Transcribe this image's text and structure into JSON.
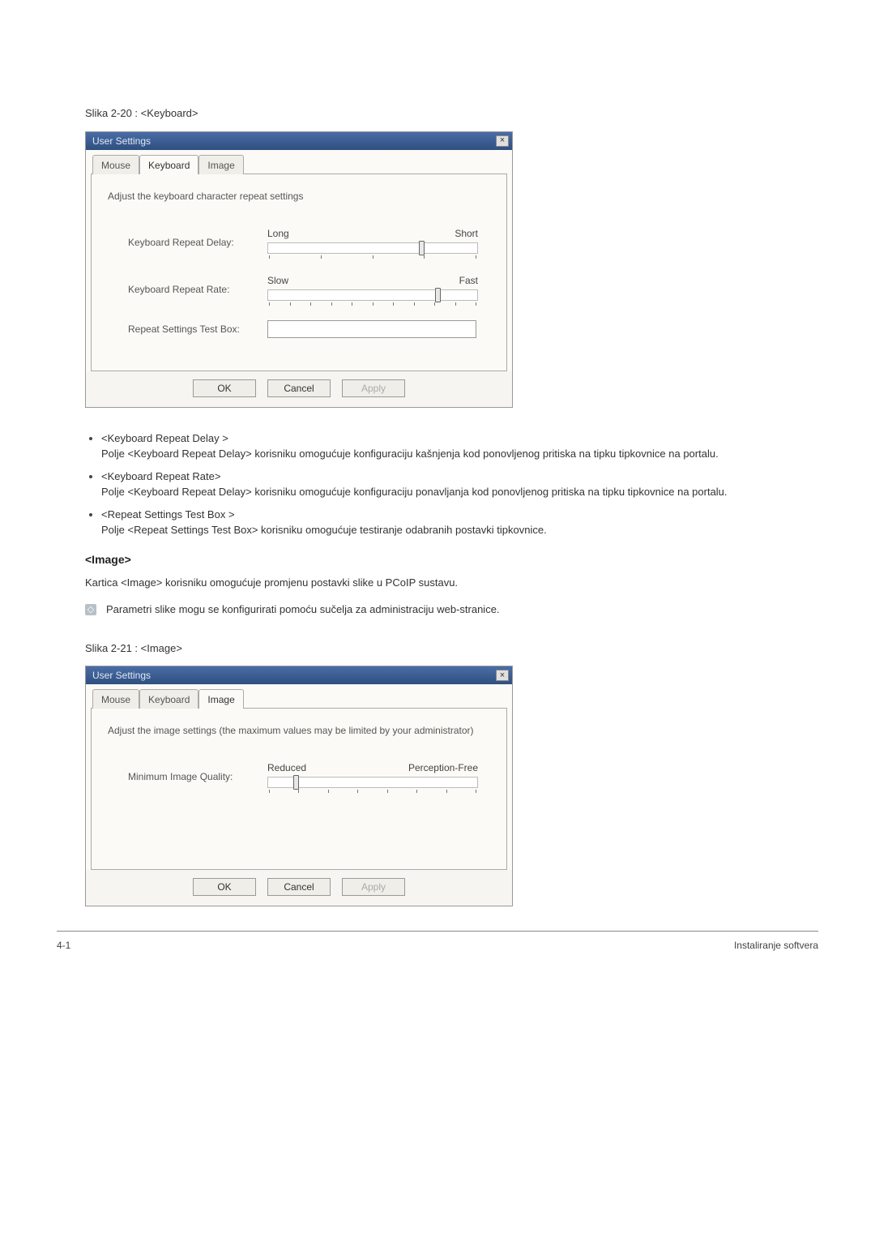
{
  "figure1": {
    "caption": "Slika 2-20 : <Keyboard>"
  },
  "dialog1": {
    "title": "User Settings",
    "tabs": [
      "Mouse",
      "Keyboard",
      "Image"
    ],
    "active_tab": "Keyboard",
    "description": "Adjust the keyboard character repeat settings",
    "row_delay_label": "Keyboard Repeat Delay:",
    "row_rate_label": "Keyboard Repeat Rate:",
    "row_test_label": "Repeat Settings Test Box:",
    "slider_delay_left": "Long",
    "slider_delay_right": "Short",
    "slider_rate_left": "Slow",
    "slider_rate_right": "Fast",
    "buttons": {
      "ok": "OK",
      "cancel": "Cancel",
      "apply": "Apply"
    }
  },
  "bullets": [
    {
      "title": "<Keyboard Repeat Delay >",
      "text": "Polje <Keyboard Repeat Delay> korisniku omogućuje konfiguraciju kašnjenja kod ponovljenog pritiska na tipku tipkovnice na portalu."
    },
    {
      "title": "<Keyboard Repeat Rate>",
      "text": "Polje <Keyboard Repeat Delay> korisniku omogućuje konfiguraciju ponavljanja kod ponovljenog pritiska na tipku tipkovnice na portalu."
    },
    {
      "title": "<Repeat Settings Test Box >",
      "text": "Polje <Repeat Settings Test Box> korisniku omogućuje testiranje odabranih postavki tipkovnice."
    }
  ],
  "section": {
    "heading": "<Image>",
    "text": "Kartica <Image> korisniku omogućuje promjenu postavki slike u PCoIP sustavu.",
    "note": "Parametri slike mogu se konfigurirati pomoću sučelja za administraciju web-stranice."
  },
  "figure2": {
    "caption": "Slika 2-21 : <Image>"
  },
  "dialog2": {
    "title": "User Settings",
    "tabs": [
      "Mouse",
      "Keyboard",
      "Image"
    ],
    "active_tab": "Image",
    "description": "Adjust the image settings (the maximum values may be limited by your administrator)",
    "row_quality_label": "Minimum Image Quality:",
    "slider_quality_left": "Reduced",
    "slider_quality_right": "Perception-Free",
    "buttons": {
      "ok": "OK",
      "cancel": "Cancel",
      "apply": "Apply"
    }
  },
  "footer": {
    "left": "4-1",
    "right": "Instaliranje softvera"
  }
}
